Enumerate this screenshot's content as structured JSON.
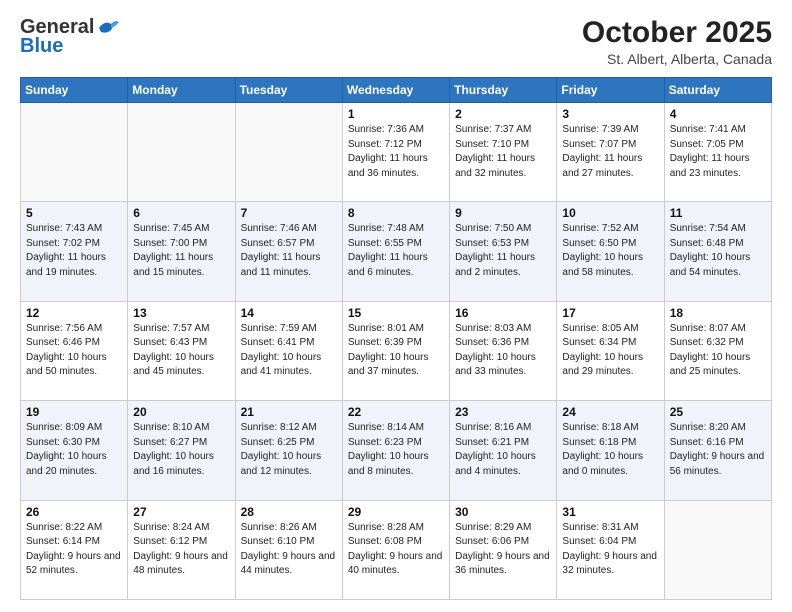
{
  "header": {
    "logo_general": "General",
    "logo_blue": "Blue",
    "month_title": "October 2025",
    "location": "St. Albert, Alberta, Canada"
  },
  "days_of_week": [
    "Sunday",
    "Monday",
    "Tuesday",
    "Wednesday",
    "Thursday",
    "Friday",
    "Saturday"
  ],
  "weeks": [
    [
      {
        "day": "",
        "sunrise": "",
        "sunset": "",
        "daylight": "",
        "empty": true
      },
      {
        "day": "",
        "sunrise": "",
        "sunset": "",
        "daylight": "",
        "empty": true
      },
      {
        "day": "",
        "sunrise": "",
        "sunset": "",
        "daylight": "",
        "empty": true
      },
      {
        "day": "1",
        "sunrise": "Sunrise: 7:36 AM",
        "sunset": "Sunset: 7:12 PM",
        "daylight": "Daylight: 11 hours and 36 minutes.",
        "empty": false
      },
      {
        "day": "2",
        "sunrise": "Sunrise: 7:37 AM",
        "sunset": "Sunset: 7:10 PM",
        "daylight": "Daylight: 11 hours and 32 minutes.",
        "empty": false
      },
      {
        "day": "3",
        "sunrise": "Sunrise: 7:39 AM",
        "sunset": "Sunset: 7:07 PM",
        "daylight": "Daylight: 11 hours and 27 minutes.",
        "empty": false
      },
      {
        "day": "4",
        "sunrise": "Sunrise: 7:41 AM",
        "sunset": "Sunset: 7:05 PM",
        "daylight": "Daylight: 11 hours and 23 minutes.",
        "empty": false
      }
    ],
    [
      {
        "day": "5",
        "sunrise": "Sunrise: 7:43 AM",
        "sunset": "Sunset: 7:02 PM",
        "daylight": "Daylight: 11 hours and 19 minutes.",
        "empty": false
      },
      {
        "day": "6",
        "sunrise": "Sunrise: 7:45 AM",
        "sunset": "Sunset: 7:00 PM",
        "daylight": "Daylight: 11 hours and 15 minutes.",
        "empty": false
      },
      {
        "day": "7",
        "sunrise": "Sunrise: 7:46 AM",
        "sunset": "Sunset: 6:57 PM",
        "daylight": "Daylight: 11 hours and 11 minutes.",
        "empty": false
      },
      {
        "day": "8",
        "sunrise": "Sunrise: 7:48 AM",
        "sunset": "Sunset: 6:55 PM",
        "daylight": "Daylight: 11 hours and 6 minutes.",
        "empty": false
      },
      {
        "day": "9",
        "sunrise": "Sunrise: 7:50 AM",
        "sunset": "Sunset: 6:53 PM",
        "daylight": "Daylight: 11 hours and 2 minutes.",
        "empty": false
      },
      {
        "day": "10",
        "sunrise": "Sunrise: 7:52 AM",
        "sunset": "Sunset: 6:50 PM",
        "daylight": "Daylight: 10 hours and 58 minutes.",
        "empty": false
      },
      {
        "day": "11",
        "sunrise": "Sunrise: 7:54 AM",
        "sunset": "Sunset: 6:48 PM",
        "daylight": "Daylight: 10 hours and 54 minutes.",
        "empty": false
      }
    ],
    [
      {
        "day": "12",
        "sunrise": "Sunrise: 7:56 AM",
        "sunset": "Sunset: 6:46 PM",
        "daylight": "Daylight: 10 hours and 50 minutes.",
        "empty": false
      },
      {
        "day": "13",
        "sunrise": "Sunrise: 7:57 AM",
        "sunset": "Sunset: 6:43 PM",
        "daylight": "Daylight: 10 hours and 45 minutes.",
        "empty": false
      },
      {
        "day": "14",
        "sunrise": "Sunrise: 7:59 AM",
        "sunset": "Sunset: 6:41 PM",
        "daylight": "Daylight: 10 hours and 41 minutes.",
        "empty": false
      },
      {
        "day": "15",
        "sunrise": "Sunrise: 8:01 AM",
        "sunset": "Sunset: 6:39 PM",
        "daylight": "Daylight: 10 hours and 37 minutes.",
        "empty": false
      },
      {
        "day": "16",
        "sunrise": "Sunrise: 8:03 AM",
        "sunset": "Sunset: 6:36 PM",
        "daylight": "Daylight: 10 hours and 33 minutes.",
        "empty": false
      },
      {
        "day": "17",
        "sunrise": "Sunrise: 8:05 AM",
        "sunset": "Sunset: 6:34 PM",
        "daylight": "Daylight: 10 hours and 29 minutes.",
        "empty": false
      },
      {
        "day": "18",
        "sunrise": "Sunrise: 8:07 AM",
        "sunset": "Sunset: 6:32 PM",
        "daylight": "Daylight: 10 hours and 25 minutes.",
        "empty": false
      }
    ],
    [
      {
        "day": "19",
        "sunrise": "Sunrise: 8:09 AM",
        "sunset": "Sunset: 6:30 PM",
        "daylight": "Daylight: 10 hours and 20 minutes.",
        "empty": false
      },
      {
        "day": "20",
        "sunrise": "Sunrise: 8:10 AM",
        "sunset": "Sunset: 6:27 PM",
        "daylight": "Daylight: 10 hours and 16 minutes.",
        "empty": false
      },
      {
        "day": "21",
        "sunrise": "Sunrise: 8:12 AM",
        "sunset": "Sunset: 6:25 PM",
        "daylight": "Daylight: 10 hours and 12 minutes.",
        "empty": false
      },
      {
        "day": "22",
        "sunrise": "Sunrise: 8:14 AM",
        "sunset": "Sunset: 6:23 PM",
        "daylight": "Daylight: 10 hours and 8 minutes.",
        "empty": false
      },
      {
        "day": "23",
        "sunrise": "Sunrise: 8:16 AM",
        "sunset": "Sunset: 6:21 PM",
        "daylight": "Daylight: 10 hours and 4 minutes.",
        "empty": false
      },
      {
        "day": "24",
        "sunrise": "Sunrise: 8:18 AM",
        "sunset": "Sunset: 6:18 PM",
        "daylight": "Daylight: 10 hours and 0 minutes.",
        "empty": false
      },
      {
        "day": "25",
        "sunrise": "Sunrise: 8:20 AM",
        "sunset": "Sunset: 6:16 PM",
        "daylight": "Daylight: 9 hours and 56 minutes.",
        "empty": false
      }
    ],
    [
      {
        "day": "26",
        "sunrise": "Sunrise: 8:22 AM",
        "sunset": "Sunset: 6:14 PM",
        "daylight": "Daylight: 9 hours and 52 minutes.",
        "empty": false
      },
      {
        "day": "27",
        "sunrise": "Sunrise: 8:24 AM",
        "sunset": "Sunset: 6:12 PM",
        "daylight": "Daylight: 9 hours and 48 minutes.",
        "empty": false
      },
      {
        "day": "28",
        "sunrise": "Sunrise: 8:26 AM",
        "sunset": "Sunset: 6:10 PM",
        "daylight": "Daylight: 9 hours and 44 minutes.",
        "empty": false
      },
      {
        "day": "29",
        "sunrise": "Sunrise: 8:28 AM",
        "sunset": "Sunset: 6:08 PM",
        "daylight": "Daylight: 9 hours and 40 minutes.",
        "empty": false
      },
      {
        "day": "30",
        "sunrise": "Sunrise: 8:29 AM",
        "sunset": "Sunset: 6:06 PM",
        "daylight": "Daylight: 9 hours and 36 minutes.",
        "empty": false
      },
      {
        "day": "31",
        "sunrise": "Sunrise: 8:31 AM",
        "sunset": "Sunset: 6:04 PM",
        "daylight": "Daylight: 9 hours and 32 minutes.",
        "empty": false
      },
      {
        "day": "",
        "sunrise": "",
        "sunset": "",
        "daylight": "",
        "empty": true
      }
    ]
  ]
}
